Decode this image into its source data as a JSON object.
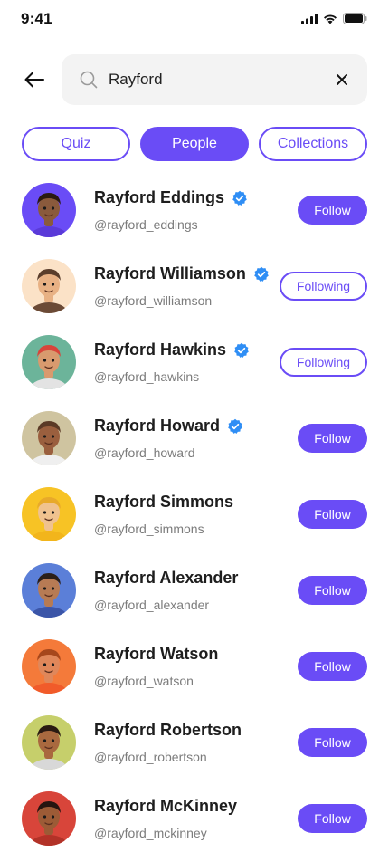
{
  "status_bar": {
    "time": "9:41"
  },
  "search": {
    "value": "Rayford",
    "placeholder": "Search"
  },
  "tabs": [
    {
      "label": "Quiz",
      "active": false
    },
    {
      "label": "People",
      "active": true
    },
    {
      "label": "Collections",
      "active": false
    }
  ],
  "people": [
    {
      "name": "Rayford Eddings",
      "handle": "@rayford_eddings",
      "verified": true,
      "button": "Follow",
      "following": false,
      "avatar_bg": "#6a4cf6",
      "skin": "#8a5a3c",
      "hair": "#2a1a12",
      "shirt": "#5a3ad8"
    },
    {
      "name": "Rayford Williamson",
      "handle": "@rayford_williamson",
      "verified": true,
      "button": "Following",
      "following": true,
      "avatar_bg": "#fbe2c7",
      "skin": "#e8b184",
      "hair": "#5a3d2b",
      "shirt": "#6b4a36"
    },
    {
      "name": "Rayford Hawkins",
      "handle": "@rayford_hawkins",
      "verified": true,
      "button": "Following",
      "following": true,
      "avatar_bg": "#6cb49a",
      "skin": "#d89a6e",
      "hair": "#d9443a",
      "shirt": "#e3e3e3"
    },
    {
      "name": "Rayford Howard",
      "handle": "@rayford_howard",
      "verified": true,
      "button": "Follow",
      "following": false,
      "avatar_bg": "#cfc4a0",
      "skin": "#9a5f3e",
      "hair": "#5b3a26",
      "shirt": "#efefef"
    },
    {
      "name": "Rayford Simmons",
      "handle": "@rayford_simmons",
      "verified": false,
      "button": "Follow",
      "following": false,
      "avatar_bg": "#f7c325",
      "skin": "#f0c28f",
      "hair": "#e8a92a",
      "shirt": "#f2b51b"
    },
    {
      "name": "Rayford Alexander",
      "handle": "@rayford_alexander",
      "verified": false,
      "button": "Follow",
      "following": false,
      "avatar_bg": "#5b7fd8",
      "skin": "#b77b54",
      "hair": "#2b1f19",
      "shirt": "#3b55a8"
    },
    {
      "name": "Rayford Watson",
      "handle": "@rayford_watson",
      "verified": false,
      "button": "Follow",
      "following": false,
      "avatar_bg": "#f47a3a",
      "skin": "#e0875a",
      "hair": "#a6471c",
      "shirt": "#f15b2a"
    },
    {
      "name": "Rayford Robertson",
      "handle": "@rayford_robertson",
      "verified": false,
      "button": "Follow",
      "following": false,
      "avatar_bg": "#c6cf6b",
      "skin": "#a9693f",
      "hair": "#2a1a12",
      "shirt": "#d8d8d8"
    },
    {
      "name": "Rayford McKinney",
      "handle": "@rayford_mckinney",
      "verified": false,
      "button": "Follow",
      "following": false,
      "avatar_bg": "#d8453a",
      "skin": "#9c5b36",
      "hair": "#251510",
      "shirt": "#b23228"
    }
  ],
  "colors": {
    "accent": "#6a4cf6",
    "verified": "#2f8ef5",
    "search_bg": "#f3f3f3",
    "handle_text": "#7c7c7c"
  },
  "icons": {
    "back": "arrow-left-icon",
    "search": "search-icon",
    "clear": "close-icon",
    "verified": "verified-badge-icon",
    "signal": "signal-icon",
    "wifi": "wifi-icon",
    "battery": "battery-icon"
  }
}
